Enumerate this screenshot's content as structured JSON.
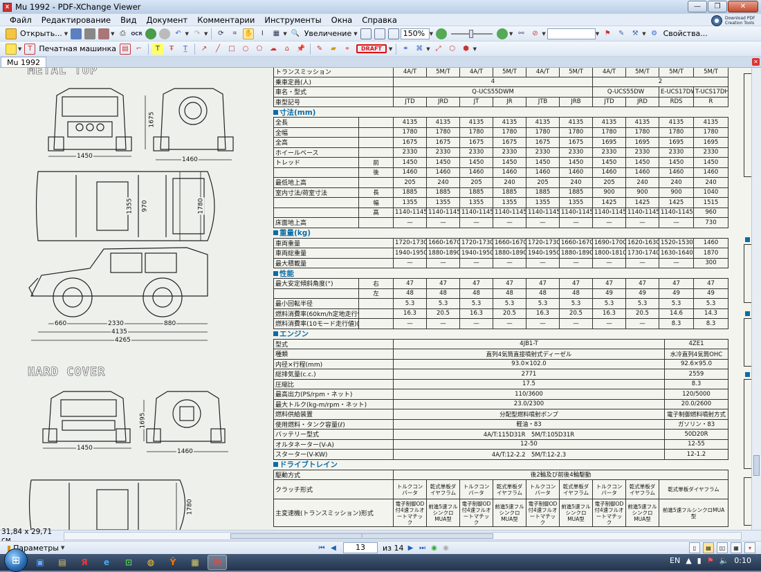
{
  "window": {
    "title": "Mu 1992 - PDF-XChange Viewer",
    "min": "—",
    "max": "❐",
    "close": "✕"
  },
  "menu": [
    "Файл",
    "Редактирование",
    "Вид",
    "Документ",
    "Комментарии",
    "Инструменты",
    "Окна",
    "Справка"
  ],
  "pdf_tools": {
    "line1": "Download PDF",
    "line2": "Creation Tools"
  },
  "toolbar1": {
    "open_label": "Открыть...",
    "zoom_label": "Увеличение",
    "zoom_value": "150%",
    "properties_label": "Свойства..."
  },
  "toolbar2": {
    "typewriter_label": "Печатная машинка",
    "draft_label": "DRAFT"
  },
  "tab": {
    "label": "Mu 1992"
  },
  "drawings": {
    "heading1": "METAL TOP",
    "heading2": "HARD COVER",
    "dims": [
      "1675",
      "1450",
      "1460",
      "1355",
      "970",
      "1780",
      "660",
      "2330",
      "880",
      "4135",
      "4265",
      "1695",
      "1450",
      "1460",
      "1780"
    ]
  },
  "spec_top": [
    [
      "トランスミッション",
      "4A/T",
      "5M/T",
      "4A/T",
      "5M/T",
      "4A/T",
      "5M/T",
      "4A/T",
      "5M/T",
      "5M/T",
      "5M/T"
    ],
    [
      "乗車定員(人)",
      "4",
      "2"
    ],
    [
      "車名・型式",
      "Q-UCS55DWM",
      "Q-UCS55DW",
      "E-UCS17DW",
      "T-UCS17DH"
    ],
    [
      "車型記号",
      "JTD",
      "JRD",
      "JT",
      "JR",
      "JTB",
      "JRB",
      "JTD",
      "JRD",
      "RDS",
      "R"
    ]
  ],
  "sec_dims": "寸法(mm)",
  "dims_rows": [
    {
      "label": "全長",
      "sub": "",
      "vals": [
        "4135",
        "4135",
        "4135",
        "4135",
        "4135",
        "4135",
        "4135",
        "4135",
        "4135",
        "4135"
      ]
    },
    {
      "label": "全幅",
      "sub": "",
      "vals": [
        "1780",
        "1780",
        "1780",
        "1780",
        "1780",
        "1780",
        "1780",
        "1780",
        "1780",
        "1780"
      ]
    },
    {
      "label": "全高",
      "sub": "",
      "vals": [
        "1675",
        "1675",
        "1675",
        "1675",
        "1675",
        "1675",
        "1695",
        "1695",
        "1695",
        "1695"
      ]
    },
    {
      "label": "ホイールベース",
      "sub": "",
      "vals": [
        "2330",
        "2330",
        "2330",
        "2330",
        "2330",
        "2330",
        "2330",
        "2330",
        "2330",
        "2330"
      ]
    },
    {
      "label": "トレッド",
      "sub": "前",
      "vals": [
        "1450",
        "1450",
        "1450",
        "1450",
        "1450",
        "1450",
        "1450",
        "1450",
        "1450",
        "1450"
      ]
    },
    {
      "label": "",
      "sub": "後",
      "vals": [
        "1460",
        "1460",
        "1460",
        "1460",
        "1460",
        "1460",
        "1460",
        "1460",
        "1460",
        "1460"
      ]
    },
    {
      "label": "最低地上高",
      "sub": "",
      "vals": [
        "205",
        "240",
        "205",
        "240",
        "205",
        "240",
        "205",
        "240",
        "240",
        "240"
      ]
    },
    {
      "label": "室内寸法/荷室寸法",
      "sub": "長",
      "vals": [
        "1885",
        "1885",
        "1885",
        "1885",
        "1885",
        "1885",
        "900",
        "900",
        "900",
        "1040"
      ]
    },
    {
      "label": "",
      "sub": "幅",
      "vals": [
        "1355",
        "1355",
        "1355",
        "1355",
        "1355",
        "1355",
        "1425",
        "1425",
        "1425",
        "1515"
      ]
    },
    {
      "label": "",
      "sub": "高",
      "vals": [
        "1140‹1145›",
        "1140‹1145›",
        "1140‹1145›",
        "1140‹1145›",
        "1140‹1145›",
        "1140‹1145›",
        "1140‹1145›",
        "1140‹1145›",
        "1140‹1145›",
        "960"
      ]
    },
    {
      "label": "床面地上高",
      "sub": "",
      "vals": [
        "—",
        "—",
        "—",
        "—",
        "—",
        "—",
        "—",
        "—",
        "—",
        "730"
      ]
    }
  ],
  "sec_weight": "重量(kg)",
  "weight_rows": [
    {
      "label": "車両重量",
      "vals": [
        "1720‹1730›",
        "1660‹1670›",
        "1720‹1730›",
        "1660‹1670›",
        "1720‹1730›",
        "1660‹1670›",
        "1690‹1700›",
        "1620‹1630›",
        "1520‹1530›",
        "1460"
      ]
    },
    {
      "label": "車両総重量",
      "vals": [
        "1940‹1950›",
        "1880‹1890›",
        "1940‹1950›",
        "1880‹1890›",
        "1940‹1950›",
        "1880‹1890›",
        "1800‹1810›",
        "1730‹1740›",
        "1630‹1640›",
        "1870"
      ]
    },
    {
      "label": "最大積載量",
      "vals": [
        "—",
        "—",
        "—",
        "—",
        "—",
        "—",
        "—",
        "—",
        "—",
        "300"
      ]
    }
  ],
  "sec_perf": "性能",
  "perf_rows": [
    {
      "label": "最大安定傾斜角度(°)",
      "sub": "右",
      "vals": [
        "47",
        "47",
        "47",
        "47",
        "47",
        "47",
        "47",
        "47",
        "47",
        "47"
      ]
    },
    {
      "label": "",
      "sub": "左",
      "vals": [
        "48",
        "48",
        "48",
        "48",
        "48",
        "48",
        "49",
        "49",
        "49",
        "49"
      ]
    },
    {
      "label": "最小回転半径",
      "sub": "",
      "vals": [
        "5.3",
        "5.3",
        "5.3",
        "5.3",
        "5.3",
        "5.3",
        "5.3",
        "5.3",
        "5.3",
        "5.3"
      ]
    },
    {
      "label": "燃料消費率(60km/h定地走行値)(km/ℓ)",
      "sub": "",
      "vals": [
        "16.3",
        "20.5",
        "16.3",
        "20.5",
        "16.3",
        "20.5",
        "16.3",
        "20.5",
        "14.6",
        "14.3"
      ]
    },
    {
      "label": "燃料消費率(10モード走行値)(km/ℓ)",
      "sub": "",
      "vals": [
        "—",
        "—",
        "—",
        "—",
        "—",
        "—",
        "—",
        "—",
        "8.3",
        "8.3"
      ]
    }
  ],
  "sec_engine": "エンジン",
  "engine_rows": [
    {
      "label": "型式",
      "a": "4JB1-T",
      "b": "4ZE1"
    },
    {
      "label": "種類",
      "a": "直列4気筒直接噴射式ディーゼル",
      "b": "水冷直列4気筒OHC"
    },
    {
      "label": "内径×行程(mm)",
      "a": "93.0×102.0",
      "b": "92.6×95.0"
    },
    {
      "label": "総排気量(c.c.)",
      "a": "2771",
      "b": "2559"
    },
    {
      "label": "圧縮比",
      "a": "17.5",
      "b": "8.3"
    },
    {
      "label": "最高出力(PS/rpm・ネット)",
      "a": "110/3600",
      "b": "120/5000"
    },
    {
      "label": "最大トルク(kg-m/rpm・ネット)",
      "a": "23.0/2300",
      "b": "20.0/2600"
    },
    {
      "label": "燃料供給装置",
      "a": "分配型燃料噴射ポンプ",
      "b": "電子制御燃料噴射方式"
    },
    {
      "label": "使用燃料・タンク容量(ℓ)",
      "a": "軽油・83",
      "b": "ガソリン・83"
    },
    {
      "label": "バッテリー型式",
      "a": "4A/T:115D31R　5M/T:105D31R",
      "b": "50D20R"
    },
    {
      "label": "オルタネーター(V-A)",
      "a": "12-50",
      "b": "12-55"
    },
    {
      "label": "スターター(V-KW)",
      "a": "4A/T:12-2.2　5M/T:12-2.3",
      "b": "12-1.2"
    }
  ],
  "sec_drive": "ドライブトレイン",
  "drive": {
    "drive_label": "駆動方式",
    "drive_value": "後2輪及び前後4輪駆動",
    "clutch_label": "クラッチ形式",
    "clutch_vals": [
      "トルクコンバータ",
      "乾式単板ダイヤフラム",
      "トルクコンバータ",
      "乾式単板ダイヤフラム",
      "トルクコンバータ",
      "乾式単板ダイヤフラム",
      "トルクコンバータ",
      "乾式単板ダイヤフラム",
      "乾式単板ダイヤフラム"
    ],
    "trans_label": "主変速機(トランスミッション)形式",
    "trans_vals": [
      "電子制御OD付4速フルオートマチック",
      "前進5速フルシンクロMUA型",
      "電子制御OD付4速フルオートマチック",
      "前進5速フルシンクロMUA型",
      "電子制御OD付4速フルオートマチック",
      "前進5速フルシンクロMUA型",
      "電子制御OD付4速フルオートマチック",
      "前進5速フルシンクロMUA型",
      "前進5速フルシンクロMUA型"
    ]
  },
  "status": {
    "page_size": "31,84 x 29,71 см",
    "params_label": "Параметры",
    "page_current": "13",
    "page_of": "из 14"
  },
  "taskbar": {
    "lang": "EN",
    "time": "0:10"
  }
}
